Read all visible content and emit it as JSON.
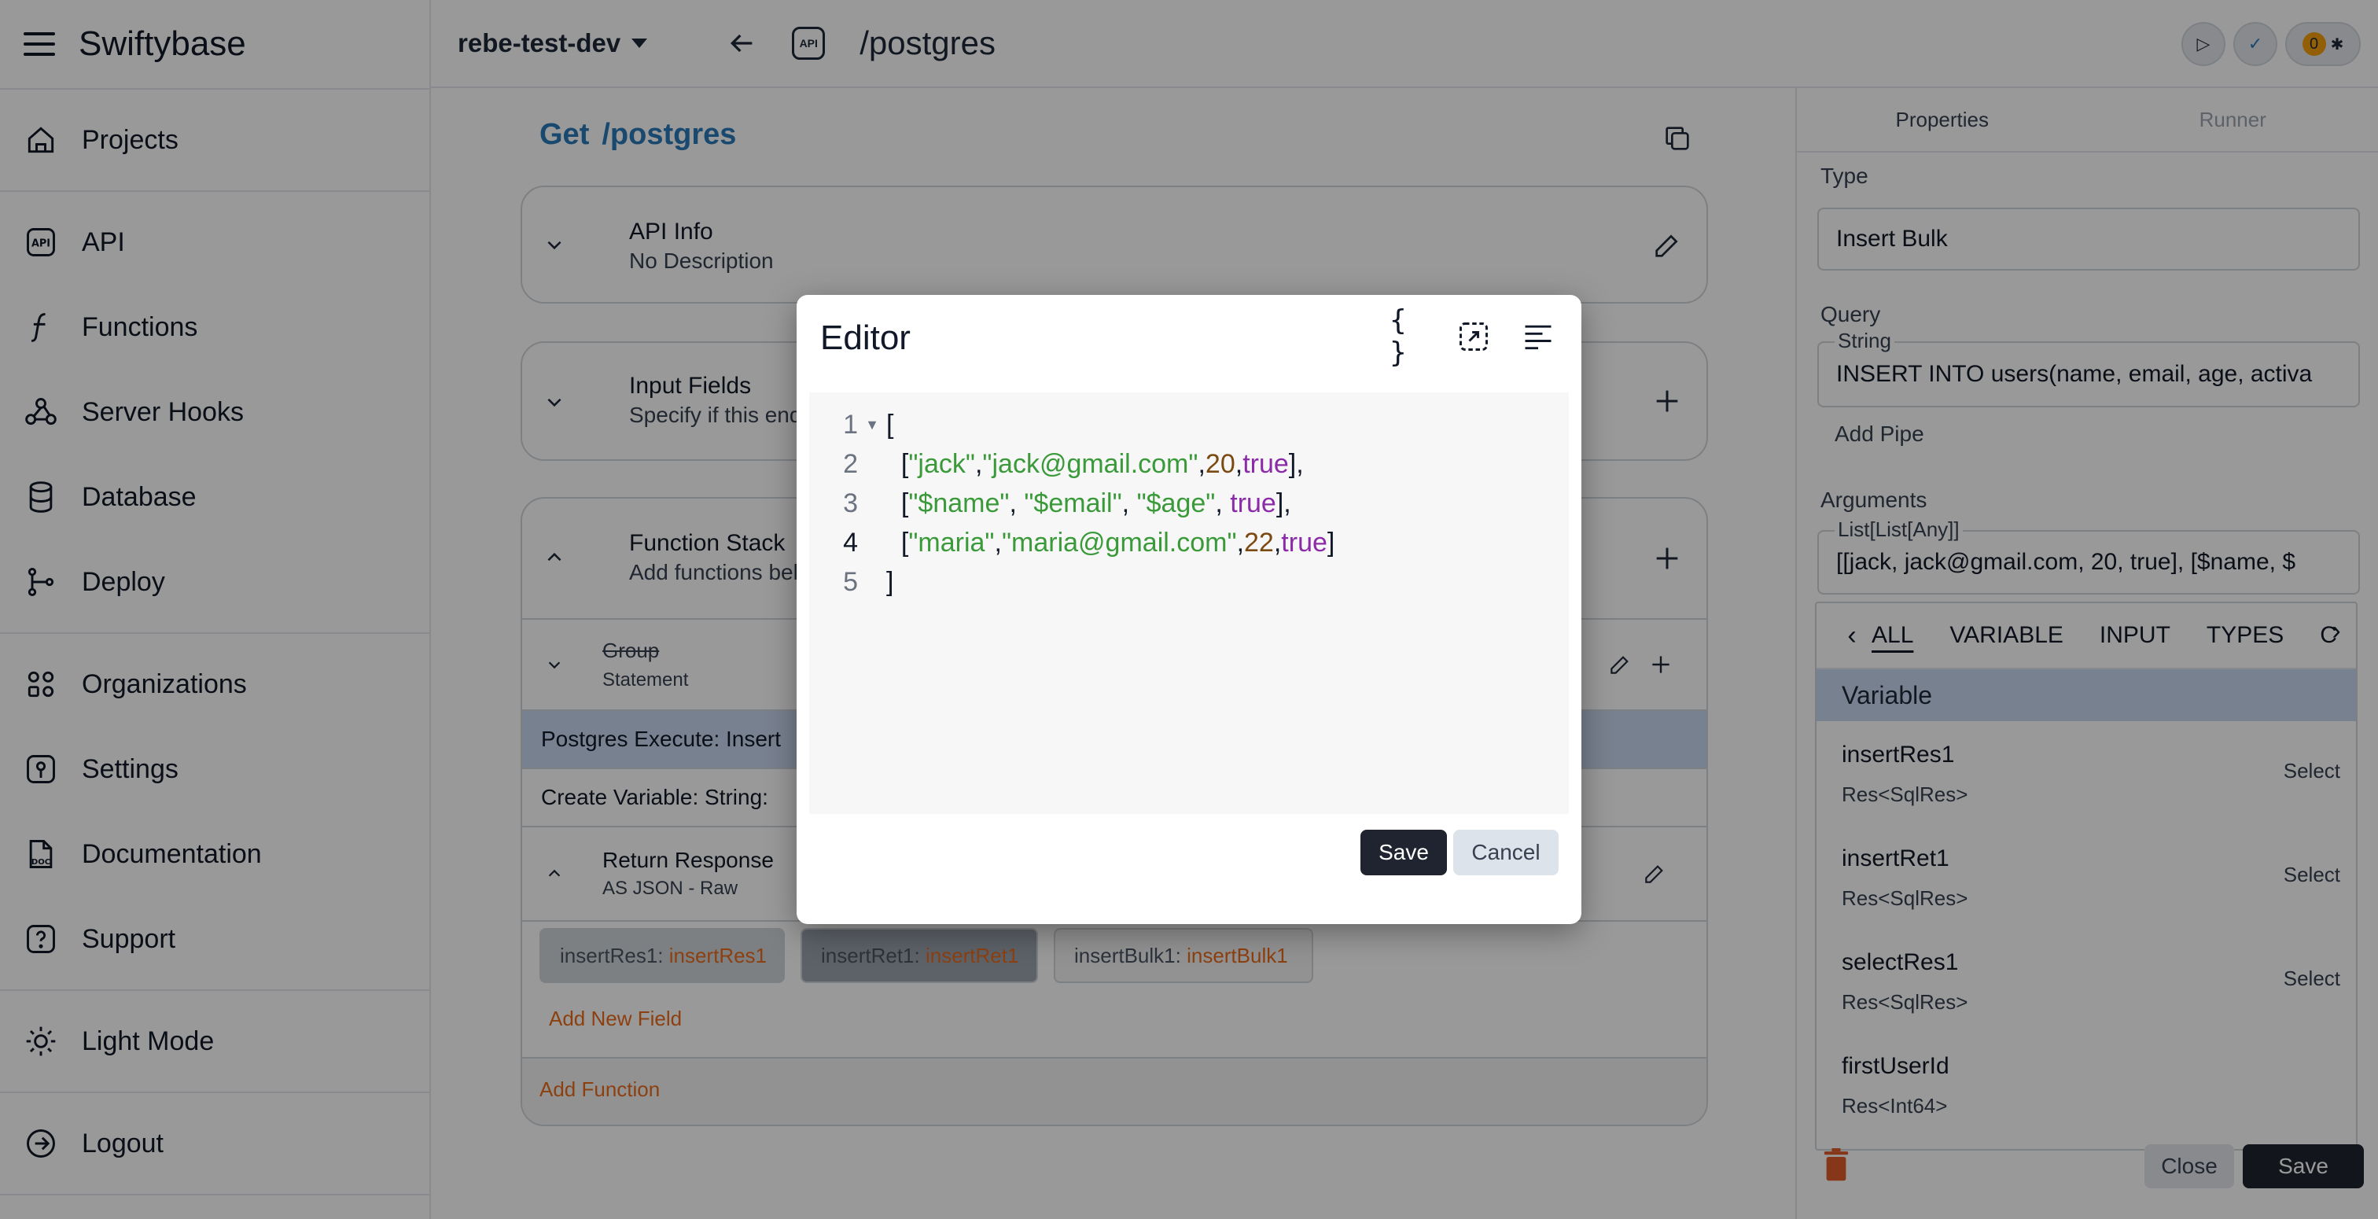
{
  "app": {
    "name": "Swiftybase"
  },
  "sidebar": {
    "items": [
      {
        "label": "Projects",
        "icon": "home-icon"
      },
      {
        "label": "API",
        "icon": "api-icon"
      },
      {
        "label": "Functions",
        "icon": "function-icon"
      },
      {
        "label": "Server Hooks",
        "icon": "webhook-icon"
      },
      {
        "label": "Database",
        "icon": "database-icon"
      },
      {
        "label": "Deploy",
        "icon": "git-branch-icon"
      },
      {
        "label": "Organizations",
        "icon": "organizations-icon"
      },
      {
        "label": "Settings",
        "icon": "settings-icon"
      },
      {
        "label": "Documentation",
        "icon": "doc-icon"
      },
      {
        "label": "Support",
        "icon": "help-icon"
      },
      {
        "label": "Light Mode",
        "icon": "sun-icon"
      },
      {
        "label": "Logout",
        "icon": "logout-icon"
      }
    ]
  },
  "topbar": {
    "project": "rebe-test-dev",
    "api_badge": "API",
    "path": "/postgres",
    "notification_count": "0"
  },
  "main": {
    "method": "Get",
    "route": "/postgres",
    "api_info": {
      "title": "API Info",
      "subtitle": "No Description"
    },
    "input_fields": {
      "title": "Input Fields",
      "subtitle": "Specify if this endp"
    },
    "function_stack": {
      "title": "Function Stack",
      "subtitle": "Add functions belo",
      "group": {
        "title": "Group",
        "subtitle": "Statement"
      },
      "rows": [
        "Postgres Execute: Insert",
        "Create Variable: String:"
      ],
      "return_response": {
        "title": "Return Response",
        "subtitle": "AS JSON - Raw"
      },
      "fields": [
        {
          "key": "insertRes1",
          "value": "insertRes1"
        },
        {
          "key": "insertRet1",
          "value": "insertRet1"
        },
        {
          "key": "insertBulk1",
          "value": "insertBulk1"
        }
      ],
      "add_field": "Add New Field",
      "add_function": "Add Function"
    }
  },
  "right_panel": {
    "tabs": [
      "Properties",
      "Runner"
    ],
    "type_label": "Type",
    "type_value": "Insert Bulk",
    "query_label": "Query",
    "query_legend": "String",
    "query_value": "INSERT INTO users(name, email, age, activa",
    "add_pipe": "Add Pipe",
    "arguments_label": "Arguments",
    "arguments_legend": "List[List[Any]]",
    "arguments_value": "[[jack, jack@gmail.com, 20, true], [$name, $",
    "close_label": "Close",
    "save_label": "Save"
  },
  "dropdown": {
    "tabs": [
      "ALL",
      "VARIABLE",
      "INPUT",
      "TYPES",
      "C"
    ],
    "header": "Variable",
    "select_label": "Select",
    "items": [
      {
        "name": "insertRes1",
        "type": "Res<SqlRes>"
      },
      {
        "name": "insertRet1",
        "type": "Res<SqlRes>"
      },
      {
        "name": "selectRes1",
        "type": "Res<SqlRes>"
      },
      {
        "name": "firstUserId",
        "type": "Res<Int64>"
      }
    ]
  },
  "editor": {
    "title": "Editor",
    "line_numbers": [
      "1",
      "2",
      "3",
      "4",
      "5"
    ],
    "save_label": "Save",
    "cancel_label": "Cancel"
  },
  "colors": {
    "accent_blue": "#2b7ab8",
    "accent_orange": "#ea6c1b",
    "highlight_row": "#c9d8ee",
    "dark_button": "#1f2430",
    "code_string": "#3a9a3a",
    "code_number": "#7a4a12",
    "code_bool": "#8b2ba7"
  }
}
